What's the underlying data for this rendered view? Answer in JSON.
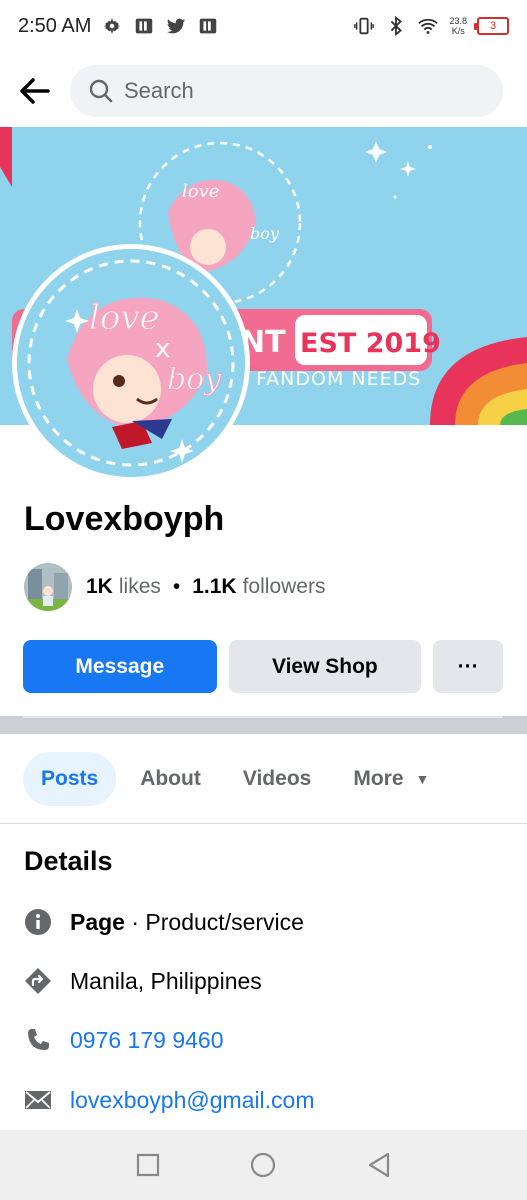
{
  "status_bar": {
    "time": "2:50 AM",
    "net_speed_value": "23.8",
    "net_speed_unit": "K/s",
    "battery": "3"
  },
  "search": {
    "placeholder": "Search"
  },
  "cover": {
    "brand_line1": "love",
    "brand_x": "x",
    "brand_line2": "boy",
    "banner_fragment": "NT",
    "est": "EST 2019",
    "tagline": "FANDOM NEEDS"
  },
  "profile": {
    "name": "Lovexboyph",
    "likes_count": "1K",
    "likes_label": "likes",
    "dot": "•",
    "followers_count": "1.1K",
    "followers_label": "followers"
  },
  "actions": {
    "message": "Message",
    "view_shop": "View Shop",
    "more": "···"
  },
  "tabs": [
    {
      "label": "Posts"
    },
    {
      "label": "About"
    },
    {
      "label": "Videos"
    },
    {
      "label": "More"
    }
  ],
  "details": {
    "title": "Details",
    "page_label": "Page",
    "page_category": " · Product/service",
    "location": "Manila, Philippines",
    "phone": "0976 179 9460",
    "email": "lovexboyph@gmail.com"
  },
  "colors": {
    "accent": "#1877f2",
    "cover_sky": "#8fd3ec",
    "rainbow_red": "#e8345a",
    "rainbow_orange": "#f28d36",
    "rainbow_yellow": "#f7d046",
    "rainbow_green": "#57b94d"
  }
}
